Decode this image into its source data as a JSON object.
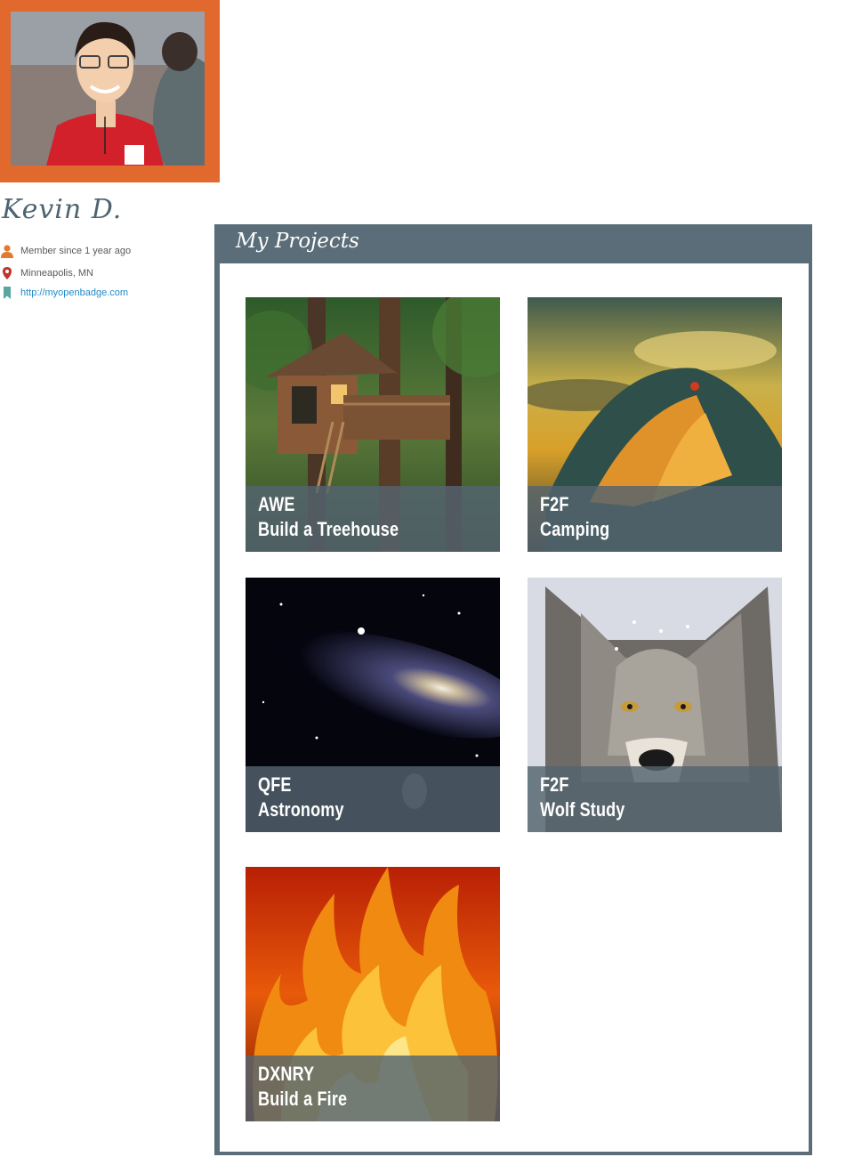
{
  "profile": {
    "name": "Kevin D.",
    "member_since": "Member since 1 year ago",
    "location": "Minneapolis, MN",
    "website": "http://myopenbadge.com"
  },
  "icons": {
    "member": "person-icon",
    "location": "map-pin-icon",
    "website": "bookmark-icon"
  },
  "colors": {
    "avatar_frame": "#e2692e",
    "panel": "#5a6d78",
    "caption_overlay": "#54646f",
    "link": "#1f8ac9",
    "member_icon": "#e07a2e",
    "location_icon": "#c0322c",
    "website_icon": "#5aa6a0"
  },
  "projects_panel": {
    "title": "My Projects",
    "items": [
      {
        "code": "AWE",
        "title": "Build a Treehouse"
      },
      {
        "code": "F2F",
        "title": "Camping"
      },
      {
        "code": "QFE",
        "title": "Astronomy"
      },
      {
        "code": "F2F",
        "title": "Wolf Study"
      },
      {
        "code": "DXNRY",
        "title": "Build a Fire"
      }
    ]
  }
}
